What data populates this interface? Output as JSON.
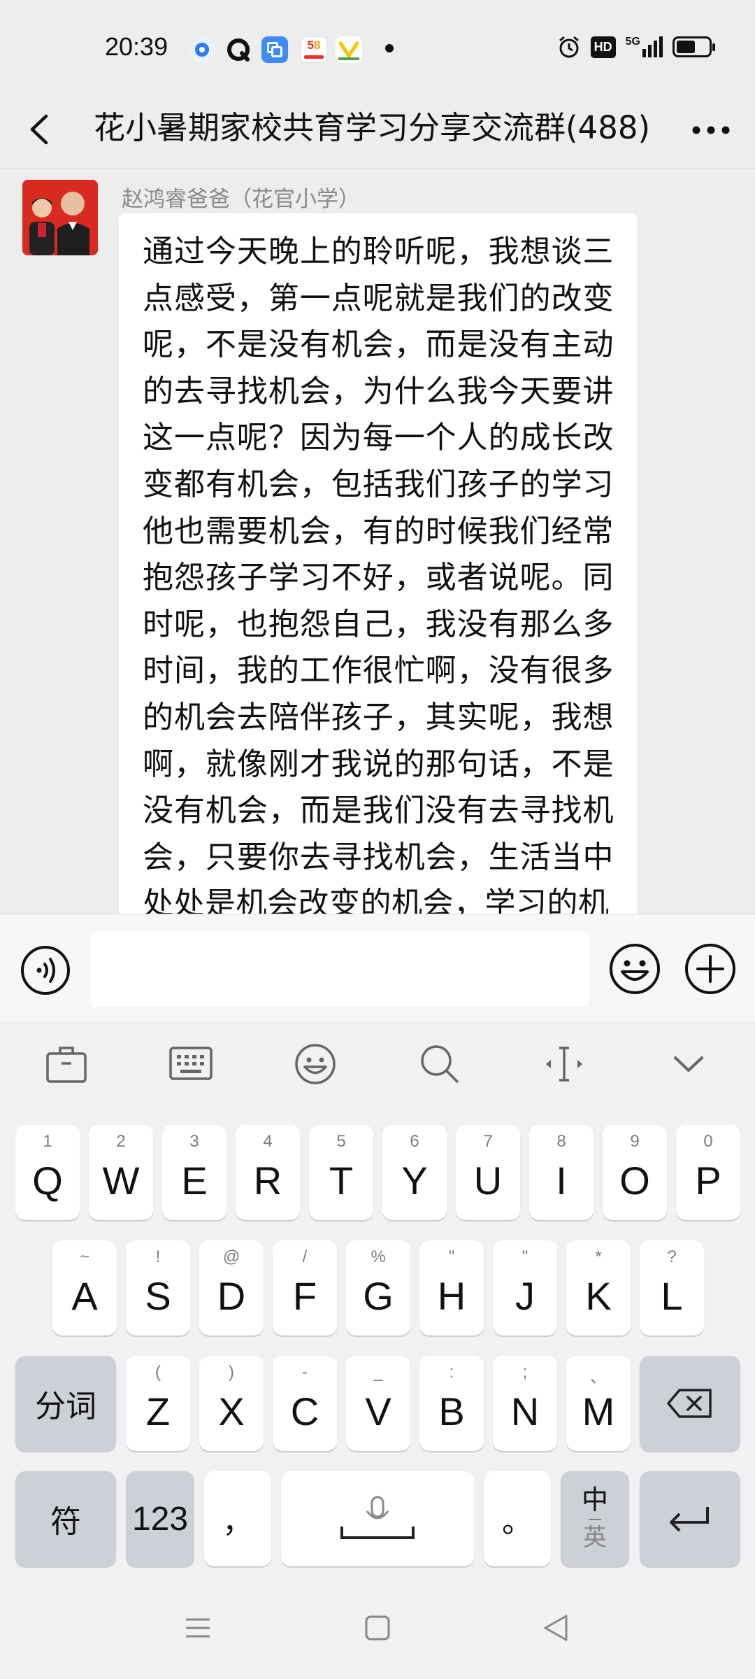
{
  "status_bar": {
    "time": "20:39",
    "app_icons": [
      "blue-circle-app-icon",
      "black-q-app-icon",
      "blue-square-app-icon",
      "58-app-icon",
      "yellow-app-icon"
    ],
    "hd_label": "HD",
    "network_label": "5G",
    "battery_icon": "battery-icon"
  },
  "header": {
    "title": "花小暑期家校共育学习分享交流群(488)"
  },
  "message": {
    "sender": "赵鸿睿爸爸（花官小学）",
    "text": "通过今天晚上的聆听呢，我想谈三点感受，第一点呢就是我们的改变呢，不是没有机会，而是没有主动的去寻找机会，为什么我今天要讲这一点呢？因为每一个人的成长改变都有机会，包括我们孩子的学习他也需要机会，有的时候我们经常抱怨孩子学习不好，或者说呢。同时呢，也抱怨自己，我没有那么多时间，我的工作很忙啊，没有很多的机会去陪伴孩子，其实呢，我想啊，就像刚才我说的那句话，不是没有机会，而是我们没有去寻找机会，只要你去寻找机会，生活当中处处是机会改变的机会，学习的机"
  },
  "keyboard": {
    "row1": [
      {
        "main": "Q",
        "sub": "1"
      },
      {
        "main": "W",
        "sub": "2"
      },
      {
        "main": "E",
        "sub": "3"
      },
      {
        "main": "R",
        "sub": "4"
      },
      {
        "main": "T",
        "sub": "5"
      },
      {
        "main": "Y",
        "sub": "6"
      },
      {
        "main": "U",
        "sub": "7"
      },
      {
        "main": "I",
        "sub": "8"
      },
      {
        "main": "O",
        "sub": "9"
      },
      {
        "main": "P",
        "sub": "0"
      }
    ],
    "row2": [
      {
        "main": "A",
        "sub": "~"
      },
      {
        "main": "S",
        "sub": "!"
      },
      {
        "main": "D",
        "sub": "@"
      },
      {
        "main": "F",
        "sub": "/"
      },
      {
        "main": "G",
        "sub": "%"
      },
      {
        "main": "H",
        "sub": "\""
      },
      {
        "main": "J",
        "sub": "\""
      },
      {
        "main": "K",
        "sub": "*"
      },
      {
        "main": "L",
        "sub": "?"
      }
    ],
    "row3": [
      {
        "main": "Z",
        "sub": "("
      },
      {
        "main": "X",
        "sub": ")"
      },
      {
        "main": "C",
        "sub": "-"
      },
      {
        "main": "V",
        "sub": "_"
      },
      {
        "main": "B",
        "sub": ":"
      },
      {
        "main": "N",
        "sub": ";"
      },
      {
        "main": "M",
        "sub": "、"
      }
    ],
    "fenci": "分词",
    "fu": "符",
    "num": "123",
    "comma": "，",
    "period": "。",
    "lang_top": "中",
    "lang_bottom": "英"
  }
}
